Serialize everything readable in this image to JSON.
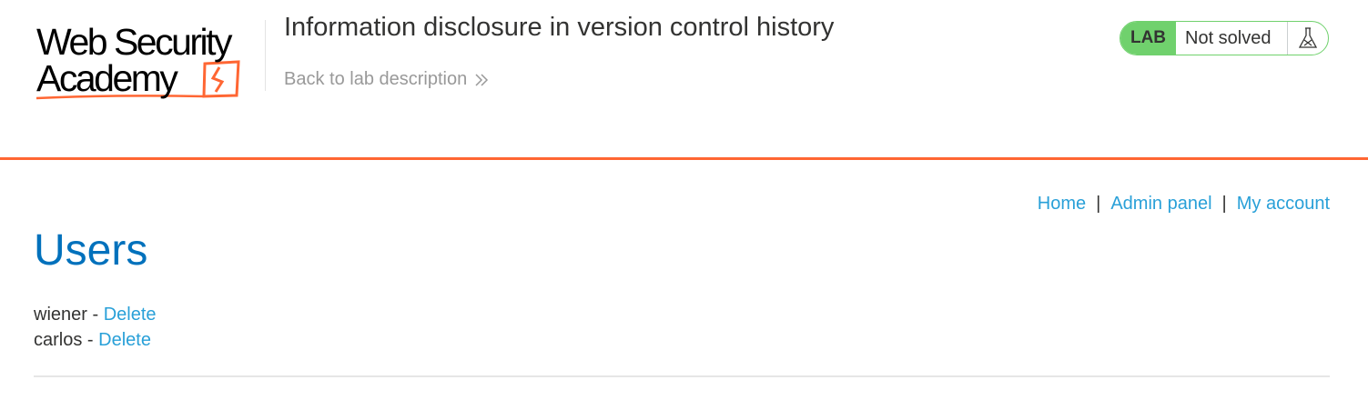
{
  "logo": {
    "line1": "Web Security",
    "line2": "Academy"
  },
  "header": {
    "lab_title": "Information disclosure in version control history",
    "back_link": "Back to lab description"
  },
  "lab_status": {
    "badge": "LAB",
    "state": "Not solved",
    "icon": "flask-icon"
  },
  "nav": {
    "items": [
      {
        "label": "Home"
      },
      {
        "label": "Admin panel"
      },
      {
        "label": "My account"
      }
    ],
    "separator": "|"
  },
  "page_title": "Users",
  "users": [
    {
      "name": "wiener",
      "separator": " - ",
      "action": "Delete"
    },
    {
      "name": "carlos",
      "separator": " - ",
      "action": "Delete"
    }
  ],
  "colors": {
    "accent_orange": "#ff6633",
    "link_blue": "#29a0d8",
    "heading_blue": "#0071bc",
    "lab_green": "#70d16d"
  }
}
